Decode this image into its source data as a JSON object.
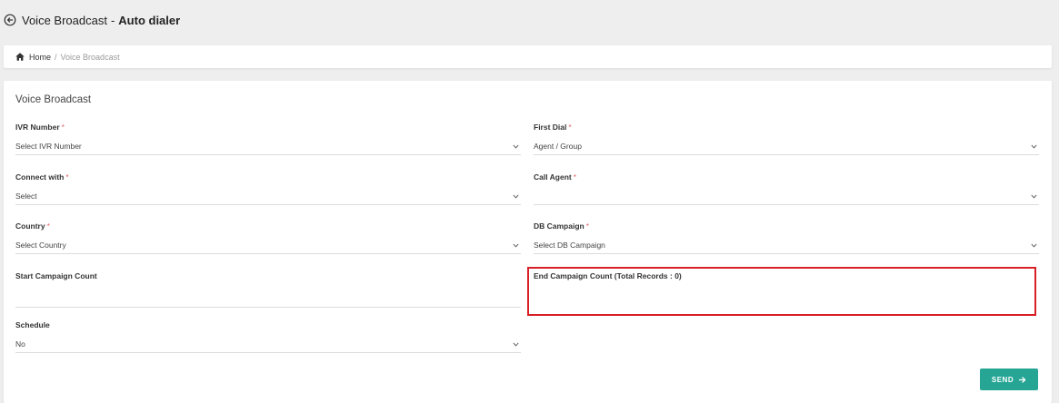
{
  "header": {
    "title_main": "Voice Broadcast",
    "title_sep": "-",
    "title_sub": "Auto dialer"
  },
  "breadcrumb": {
    "home": "Home",
    "sep": "/",
    "current": "Voice Broadcast"
  },
  "form": {
    "title": "Voice Broadcast",
    "ivr_number": {
      "label": "IVR Number",
      "required": "*",
      "value": "Select IVR Number"
    },
    "first_dial": {
      "label": "First Dial",
      "required": "*",
      "value": "Agent / Group"
    },
    "connect_with": {
      "label": "Connect with",
      "required": "*",
      "value": "Select"
    },
    "call_agent": {
      "label": "Call Agent",
      "required": "*",
      "value": ""
    },
    "country": {
      "label": "Country",
      "required": "*",
      "value": "Select Country"
    },
    "db_campaign": {
      "label": "DB Campaign",
      "required": "*",
      "value": "Select DB Campaign"
    },
    "start_campaign_count": {
      "label": "Start Campaign Count",
      "value": ""
    },
    "end_campaign_count": {
      "label": "End Campaign Count (Total Records : 0)",
      "value": ""
    },
    "schedule": {
      "label": "Schedule",
      "value": "No"
    },
    "send_label": "SEND"
  },
  "colors": {
    "accent": "#26a595",
    "highlight": "#d71f26",
    "required": "#e06666"
  }
}
